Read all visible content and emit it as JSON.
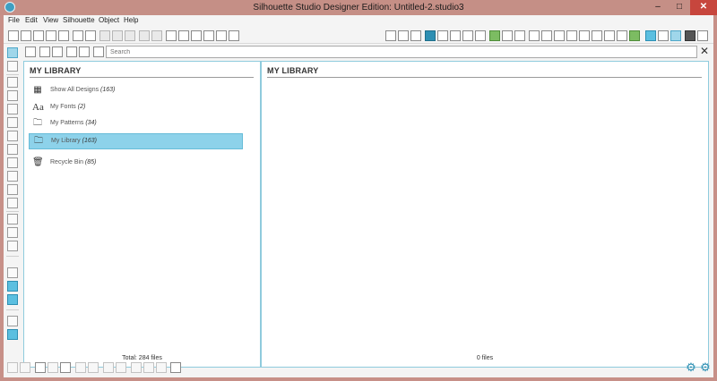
{
  "window": {
    "title": "Silhouette Studio Designer Edition: Untitled-2.studio3",
    "controls": {
      "minimize": "–",
      "maximize": "□",
      "close": "✕"
    }
  },
  "menu": [
    "File",
    "Edit",
    "View",
    "Silhouette",
    "Object",
    "Help"
  ],
  "search": {
    "placeholder": "Search",
    "value": ""
  },
  "library_panel": {
    "title": "MY LIBRARY",
    "items": [
      {
        "icon": "grid-icon",
        "label": "Show All Designs",
        "count": "(163)",
        "selected": false
      },
      {
        "icon": "font-icon",
        "label": "My Fonts",
        "count": "(2)",
        "selected": false
      },
      {
        "icon": "folder-icon",
        "label": "My Patterns",
        "count": "(34)",
        "selected": false
      },
      {
        "icon": "folder-icon",
        "label": "My Library",
        "count": "(163)",
        "selected": true
      },
      {
        "icon": "trash-icon",
        "label": "Recycle Bin",
        "count": "(85)",
        "selected": false
      }
    ],
    "footer": "Total: 284 files"
  },
  "files_panel": {
    "title": "MY LIBRARY",
    "footer": "0 files"
  },
  "colors": {
    "accent": "#5bbfe0",
    "selection": "#8dd2ea",
    "panel_border": "#8fcbdd"
  }
}
